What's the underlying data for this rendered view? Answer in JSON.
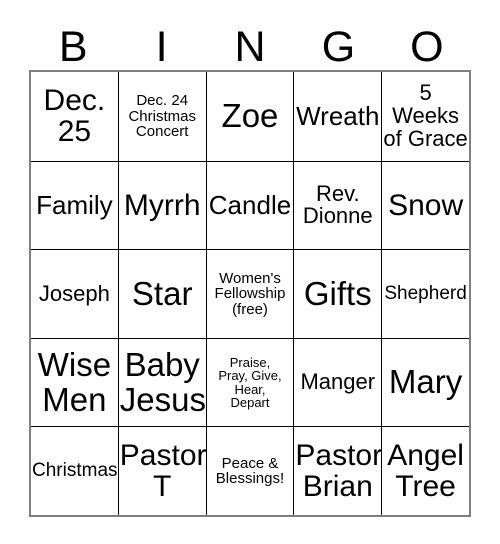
{
  "card": {
    "header": {
      "letters": [
        "B",
        "I",
        "N",
        "G",
        "O"
      ]
    },
    "columns": 5,
    "rows": 5,
    "colors": {
      "background": "#ffffff",
      "text": "#000000",
      "grid_line": "#000000",
      "outer_border": "#808080"
    },
    "cells": [
      [
        {
          "text": "Dec. 25",
          "size": "fs-xl"
        },
        {
          "text": "Dec. 24\nChristmas\nConcert",
          "size": "fs-xs"
        },
        {
          "text": "Zoe",
          "size": "fs-xxl"
        },
        {
          "text": "Wreath",
          "size": "fs-lg"
        },
        {
          "text": "5 Weeks\nof Grace",
          "size": "fs-md"
        }
      ],
      [
        {
          "text": "Family",
          "size": "fs-lg"
        },
        {
          "text": "Myrrh",
          "size": "fs-xl"
        },
        {
          "text": "Candle",
          "size": "fs-lg"
        },
        {
          "text": "Rev.\nDionne",
          "size": "fs-md"
        },
        {
          "text": "Snow",
          "size": "fs-xl"
        }
      ],
      [
        {
          "text": "Joseph",
          "size": "fs-md"
        },
        {
          "text": "Star",
          "size": "fs-xxl"
        },
        {
          "text": "Women's\nFellowship\n(free)",
          "size": "fs-xs"
        },
        {
          "text": "Gifts",
          "size": "fs-xxl"
        },
        {
          "text": "Shepherd",
          "size": "fs-sm"
        }
      ],
      [
        {
          "text": "Wise\nMen",
          "size": "fs-xxl"
        },
        {
          "text": "Baby\nJesus",
          "size": "fs-xxl"
        },
        {
          "text": "Praise,\nPray, Give,\nHear,\nDepart",
          "size": "fs-xxs"
        },
        {
          "text": "Manger",
          "size": "fs-md"
        },
        {
          "text": "Mary",
          "size": "fs-xxl"
        }
      ],
      [
        {
          "text": "Christmas",
          "size": "fs-sm"
        },
        {
          "text": "Pastor\nT",
          "size": "fs-xl"
        },
        {
          "text": "Peace &\nBlessings!",
          "size": "fs-xs"
        },
        {
          "text": "Pastor\nBrian",
          "size": "fs-xl"
        },
        {
          "text": "Angel\nTree",
          "size": "fs-xl"
        }
      ]
    ]
  }
}
